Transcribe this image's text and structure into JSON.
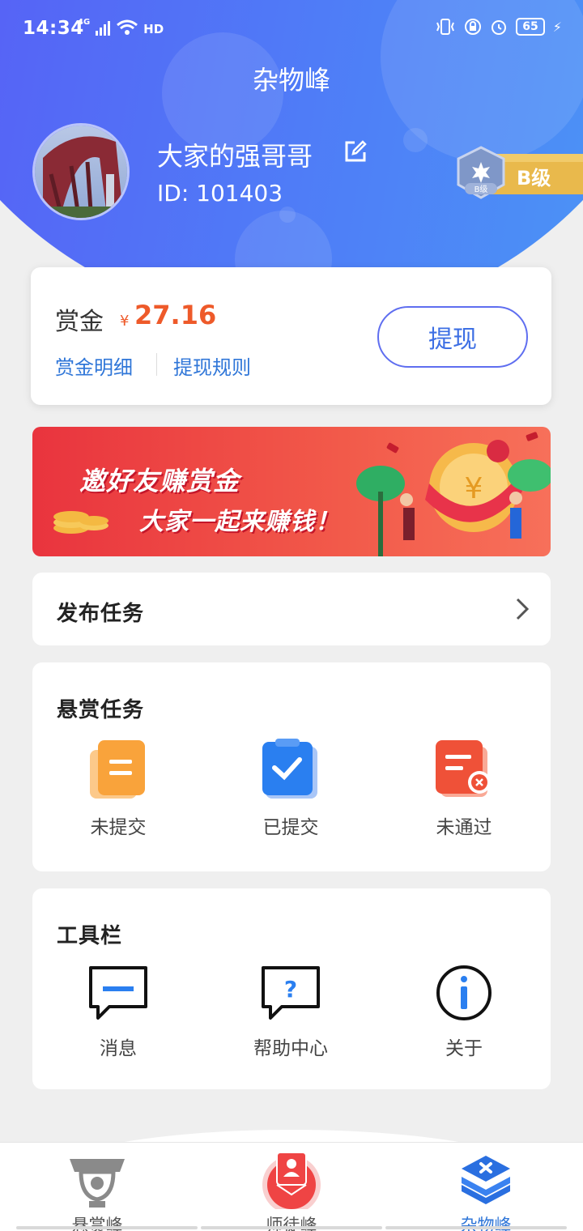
{
  "status_bar": {
    "time": "14:34",
    "network": "4G",
    "hd_label": "HD",
    "battery": "65"
  },
  "header": {
    "title": "杂物峰"
  },
  "profile": {
    "name": "大家的强哥哥",
    "id_text": "ID: 101403",
    "level_label": "B级",
    "level_badge_inner": "B级"
  },
  "reward": {
    "label": "赏金",
    "currency": "¥",
    "amount": "27.16",
    "detail_link": "赏金明细",
    "rules_link": "提现规则",
    "withdraw_button": "提现"
  },
  "banner": {
    "line1": "邀好友赚赏金",
    "line2": "大家一起来赚钱！"
  },
  "publish": {
    "label": "发布任务"
  },
  "bounty_tasks": {
    "title": "悬赏任务",
    "items": [
      {
        "label": "未提交",
        "icon": "document-icon"
      },
      {
        "label": "已提交",
        "icon": "checked-clipboard-icon"
      },
      {
        "label": "未通过",
        "icon": "rejected-document-icon"
      }
    ]
  },
  "toolbar": {
    "title": "工具栏",
    "items": [
      {
        "label": "消息",
        "icon": "message-icon"
      },
      {
        "label": "帮助中心",
        "icon": "help-bubble-icon"
      },
      {
        "label": "关于",
        "icon": "info-icon"
      }
    ]
  },
  "tabbar": {
    "items": [
      {
        "label": "悬赏峰",
        "icon": "trophy-icon",
        "active": false
      },
      {
        "label": "师徒峰",
        "icon": "mentor-icon",
        "active": false
      },
      {
        "label": "杂物峰",
        "icon": "layers-icon",
        "active": true
      }
    ]
  },
  "colors": {
    "brand_blue": "#4f7cf7",
    "accent_orange": "#ee5a2a",
    "link_blue": "#2f76d8",
    "banner_red": "#e9343e"
  }
}
